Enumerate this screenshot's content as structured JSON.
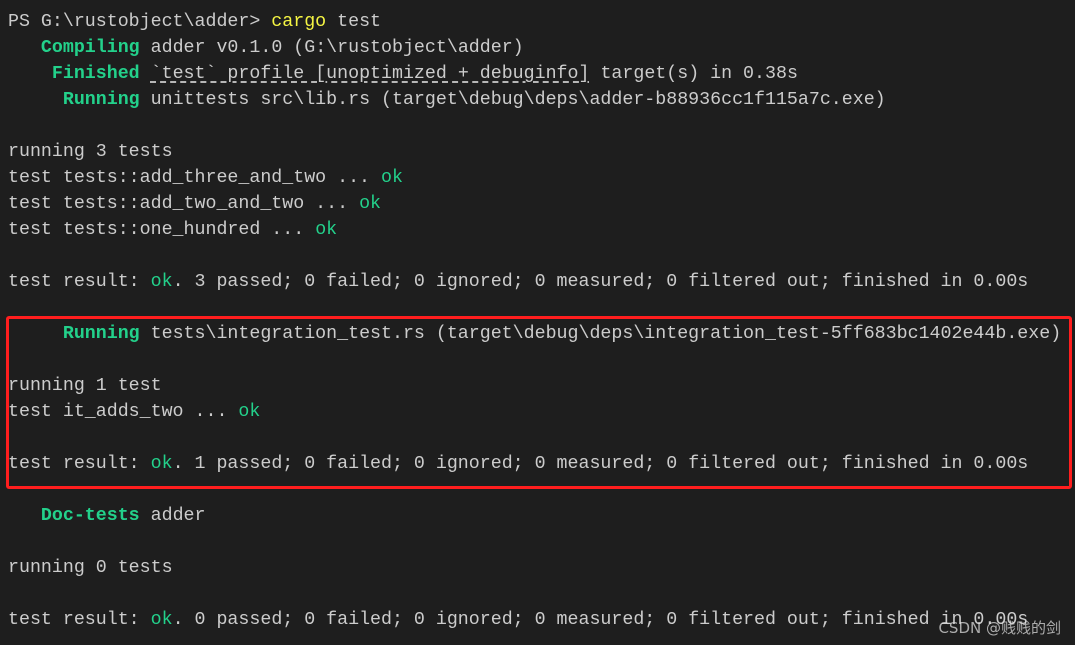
{
  "colors": {
    "background": "#1e1e1e",
    "text": "#cccccc",
    "green": "#23d18b",
    "yellow": "#f5f543",
    "highlight_box": "#ff1e1e"
  },
  "lines": [
    [
      {
        "t": "PS G:\\rustobject\\adder> "
      },
      {
        "t": "cargo",
        "c": "yellow"
      },
      {
        "t": " test"
      }
    ],
    [
      {
        "t": "   "
      },
      {
        "t": "Compiling",
        "c": "green"
      },
      {
        "t": " adder v0.1.0 (G:\\rustobject\\adder)"
      }
    ],
    [
      {
        "t": "    "
      },
      {
        "t": "Finished",
        "c": "green"
      },
      {
        "t": " "
      },
      {
        "t": "`test` profile [unoptimized + debuginfo]",
        "c": "dashed"
      },
      {
        "t": " target(s) in 0.38s"
      }
    ],
    [
      {
        "t": "     "
      },
      {
        "t": "Running",
        "c": "green"
      },
      {
        "t": " unittests src\\lib.rs (target\\debug\\deps\\adder-b88936cc1f115a7c.exe)"
      }
    ],
    [],
    [
      {
        "t": "running 3 tests"
      }
    ],
    [
      {
        "t": "test tests::add_three_and_two ... "
      },
      {
        "t": "ok",
        "c": "ok"
      }
    ],
    [
      {
        "t": "test tests::add_two_and_two ... "
      },
      {
        "t": "ok",
        "c": "ok"
      }
    ],
    [
      {
        "t": "test tests::one_hundred ... "
      },
      {
        "t": "ok",
        "c": "ok"
      }
    ],
    [],
    [
      {
        "t": "test result: "
      },
      {
        "t": "ok",
        "c": "ok"
      },
      {
        "t": ". 3 passed; 0 failed; 0 ignored; 0 measured; 0 filtered out; finished in 0.00s"
      }
    ],
    [],
    [
      {
        "t": "     "
      },
      {
        "t": "Running",
        "c": "green"
      },
      {
        "t": " tests\\integration_test.rs (target\\debug\\deps\\integration_test-5ff683bc1402e44b.exe)"
      }
    ],
    [],
    [
      {
        "t": "running 1 test"
      }
    ],
    [
      {
        "t": "test it_adds_two ... "
      },
      {
        "t": "ok",
        "c": "ok"
      }
    ],
    [],
    [
      {
        "t": "test result: "
      },
      {
        "t": "ok",
        "c": "ok"
      },
      {
        "t": ". 1 passed; 0 failed; 0 ignored; 0 measured; 0 filtered out; finished in 0.00s"
      }
    ],
    [],
    [
      {
        "t": "   "
      },
      {
        "t": "Doc-tests",
        "c": "green"
      },
      {
        "t": " adder"
      }
    ],
    [],
    [
      {
        "t": "running 0 tests"
      }
    ],
    [],
    [
      {
        "t": "test result: "
      },
      {
        "t": "ok",
        "c": "ok"
      },
      {
        "t": ". 0 passed; 0 failed; 0 ignored; 0 measured; 0 filtered out; finished in 0.00s"
      }
    ]
  ],
  "watermark": "CSDN @贱贱的剑"
}
